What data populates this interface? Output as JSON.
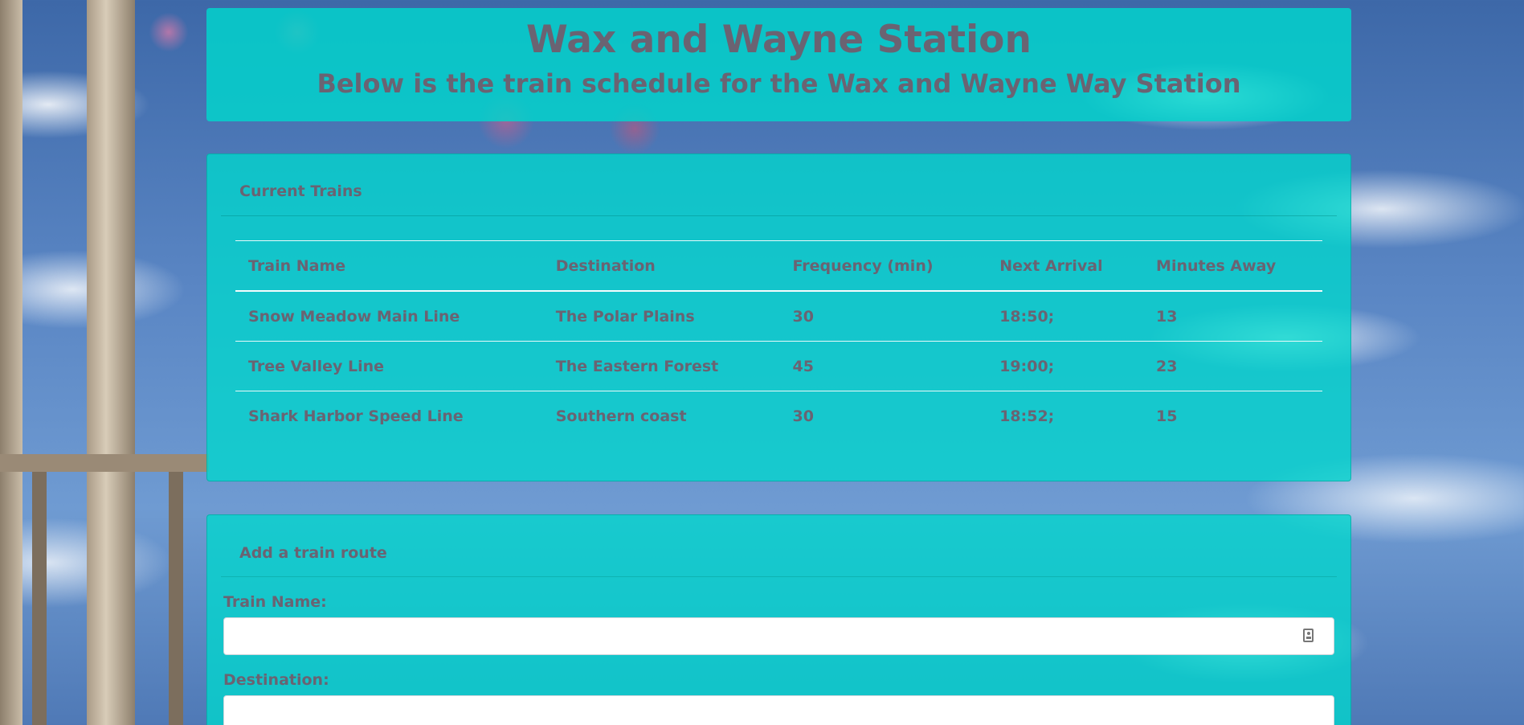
{
  "header": {
    "title": "Wax and Wayne Station",
    "subtitle": "Below is the train schedule for the Wax and Wayne Way Station"
  },
  "current_trains": {
    "title": "Current Trains",
    "columns": [
      "Train Name",
      "Destination",
      "Frequency (min)",
      "Next Arrival",
      "Minutes Away"
    ],
    "rows": [
      [
        "Snow Meadow Main Line",
        "The Polar Plains",
        "30",
        "18:50;",
        "13"
      ],
      [
        "Tree Valley Line",
        "The Eastern Forest",
        "45",
        "19:00;",
        "23"
      ],
      [
        "Shark Harbor Speed Line",
        "Southern coast",
        "30",
        "18:52;",
        "15"
      ]
    ]
  },
  "add_route": {
    "title": "Add a train route",
    "train_name_label": "Train Name:",
    "train_name_value": "",
    "destination_label": "Destination:",
    "destination_value": "",
    "train_name_icon": "contact-card-icon"
  },
  "colors": {
    "panel": "#00d7cd",
    "text": "#6a6372"
  }
}
